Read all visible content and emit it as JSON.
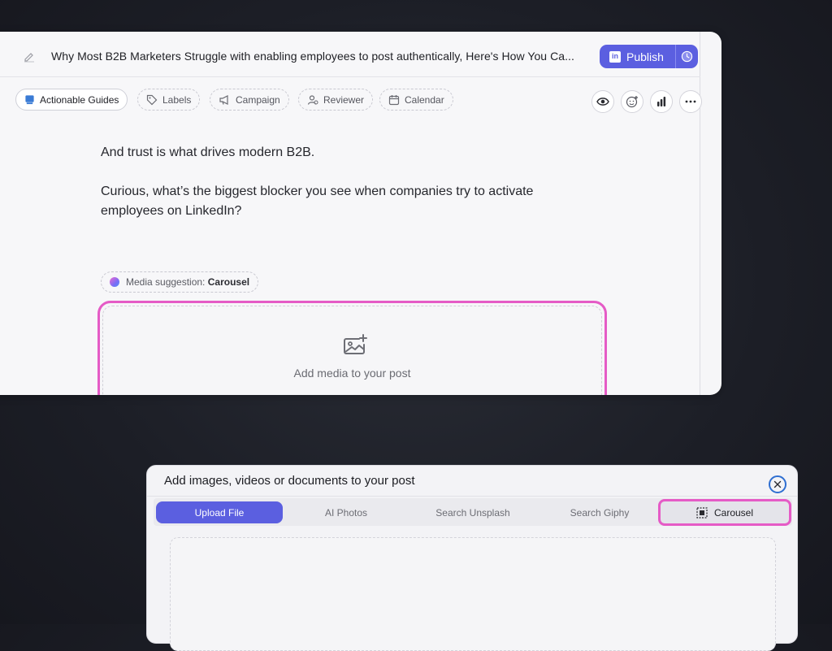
{
  "editor": {
    "title": "Why Most B2B Marketers Struggle with enabling employees to post authentically, Here's How You Ca...",
    "publish_label": "Publish",
    "linkedin_badge": "in",
    "toolbar": {
      "chips": [
        {
          "label": "Actionable Guides",
          "icon": "book-icon"
        },
        {
          "label": "Labels",
          "icon": "tag-icon"
        },
        {
          "label": "Campaign",
          "icon": "megaphone-icon"
        },
        {
          "label": "Reviewer",
          "icon": "reviewer-icon"
        },
        {
          "label": "Calendar",
          "icon": "calendar-icon"
        }
      ],
      "actions": [
        "eye-icon",
        "emoji-add-icon",
        "chart-icon",
        "more-icon"
      ]
    },
    "body": {
      "line1": "And trust is what drives modern B2B.",
      "line2": "Curious, what’s the biggest blocker you see when companies try to activate",
      "line3": "employees on LinkedIn?"
    },
    "media_suggestion": {
      "prefix": "Media suggestion:",
      "value": "Carousel"
    },
    "media_drop_label": "Add media to your post"
  },
  "modal": {
    "title": "Add images, videos or documents to your post",
    "tabs": [
      {
        "label": "Upload File",
        "active": true
      },
      {
        "label": "AI Photos"
      },
      {
        "label": "Search Unsplash"
      },
      {
        "label": "Search Giphy"
      },
      {
        "label": "Carousel",
        "icon": "carousel-icon"
      }
    ]
  },
  "colors": {
    "accent": "#5b5fe0",
    "highlight": "#e55bc6",
    "background": "#1c1e26"
  }
}
